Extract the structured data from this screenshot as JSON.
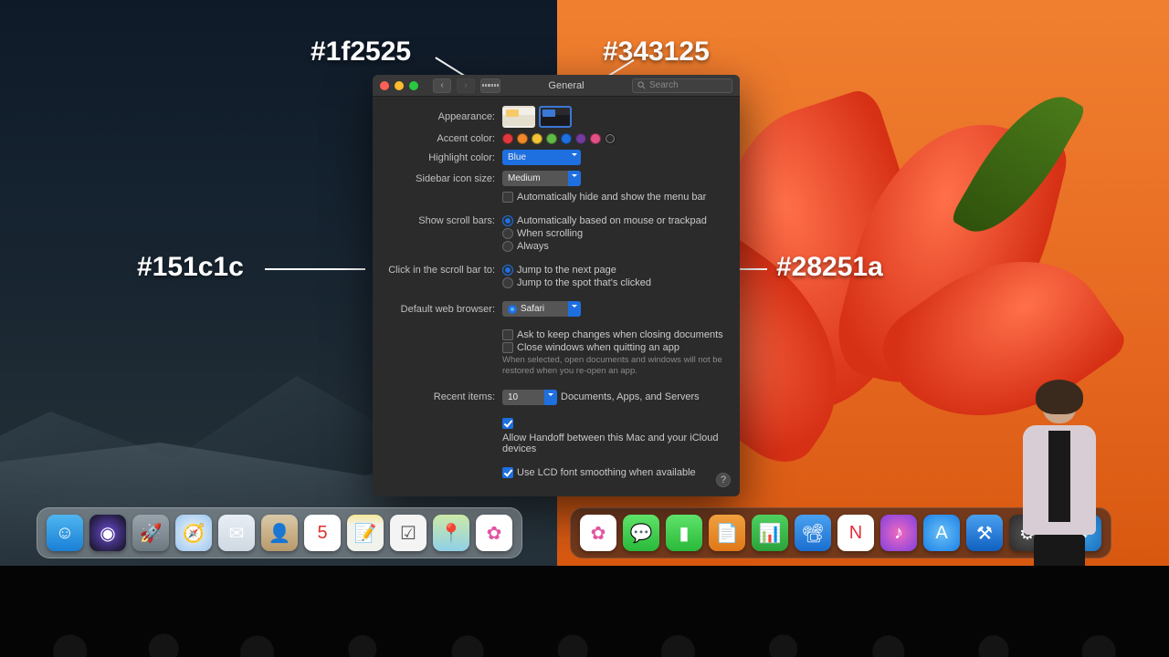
{
  "annotations": {
    "top_left": "#1f2525",
    "top_right": "#343125",
    "mid_left": "#151c1c",
    "mid_right": "#28251a"
  },
  "prefs": {
    "window_title": "General",
    "search_placeholder": "Search",
    "labels": {
      "appearance": "Appearance:",
      "accent": "Accent color:",
      "highlight": "Highlight color:",
      "sidebar": "Sidebar icon size:",
      "autohide": "Automatically hide and show the menu bar",
      "scrollbars": "Show scroll bars:",
      "scroll_opt1": "Automatically based on mouse or trackpad",
      "scroll_opt2": "When scrolling",
      "scroll_opt3": "Always",
      "click_scroll": "Click in the scroll bar to:",
      "click_opt1": "Jump to the next page",
      "click_opt2": "Jump to the spot that's clicked",
      "browser": "Default web browser:",
      "browser_value": "Safari",
      "ask_keep": "Ask to keep changes when closing documents",
      "close_win": "Close windows when quitting an app",
      "close_note": "When selected, open documents and windows will not be restored when you re-open an app.",
      "recent": "Recent items:",
      "recent_value": "10",
      "recent_suffix": "Documents, Apps, and Servers",
      "handoff": "Allow Handoff between this Mac and your iCloud devices",
      "lcd": "Use LCD font smoothing when available",
      "highlight_value": "Blue",
      "sidebar_value": "Medium"
    },
    "accent_colors": [
      "#e0383e",
      "#f0882a",
      "#f2c335",
      "#62ba46",
      "#1e6fe0",
      "#713d9a",
      "#e34f86"
    ]
  },
  "dock_left": [
    {
      "n": "finder",
      "bg": "linear-gradient(#4fb6f0,#1a7fd6)",
      "g": "☺"
    },
    {
      "n": "siri",
      "bg": "radial-gradient(circle,#6a4bd0,#101018)",
      "g": "◉"
    },
    {
      "n": "launchpad",
      "bg": "linear-gradient(#9aa4ac,#6c7880)",
      "g": "🚀"
    },
    {
      "n": "safari",
      "bg": "radial-gradient(circle,#eef5fb,#9cc6ee)",
      "g": "🧭"
    },
    {
      "n": "mail",
      "bg": "linear-gradient(#e8eef4,#cfd9e2)",
      "g": "✉"
    },
    {
      "n": "contacts",
      "bg": "linear-gradient(#d9c9a8,#b89a6a)",
      "g": "👤"
    },
    {
      "n": "calendar",
      "bg": "#fff",
      "g": "5",
      "c": "#e03030"
    },
    {
      "n": "notes",
      "bg": "linear-gradient(#f7e79a,#f2f2ec 30%)",
      "g": "📝"
    },
    {
      "n": "reminders",
      "bg": "#f4f4f4",
      "g": "☑",
      "c": "#555"
    },
    {
      "n": "maps",
      "bg": "linear-gradient(#cde9a7,#8fd0e8)",
      "g": "📍"
    },
    {
      "n": "photos",
      "bg": "#fff",
      "g": "✿",
      "c": "#e055a0"
    }
  ],
  "dock_right": [
    {
      "n": "photos",
      "bg": "#fff",
      "g": "✿",
      "c": "#e055a0"
    },
    {
      "n": "messages",
      "bg": "linear-gradient(#5fe36a,#29b93a)",
      "g": "💬"
    },
    {
      "n": "facetime",
      "bg": "linear-gradient(#5fe36a,#29b93a)",
      "g": "▮"
    },
    {
      "n": "pages",
      "bg": "linear-gradient(#f0a040,#e07818)",
      "g": "📄"
    },
    {
      "n": "numbers",
      "bg": "linear-gradient(#4fd060,#2aa33a)",
      "g": "📊"
    },
    {
      "n": "keynote",
      "bg": "linear-gradient(#4aa0f0,#1a6fd0)",
      "g": "📽"
    },
    {
      "n": "news",
      "bg": "#fff",
      "g": "N",
      "c": "#e03040"
    },
    {
      "n": "itunes",
      "bg": "radial-gradient(circle,#f06ac0,#8040e0)",
      "g": "♪"
    },
    {
      "n": "appstore",
      "bg": "radial-gradient(circle,#6ac0f5,#1a80e8)",
      "g": "A"
    },
    {
      "n": "xcode",
      "bg": "linear-gradient(#4aa0f0,#1060c0)",
      "g": "⚒"
    },
    {
      "n": "settings",
      "bg": "radial-gradient(circle,#555,#2a2a2a)",
      "g": "⚙"
    }
  ],
  "dock_right_extra": {
    "n": "downloads",
    "bg": "radial-gradient(circle,#3a9fe0,#1a6fc0)",
    "g": "⬇"
  }
}
